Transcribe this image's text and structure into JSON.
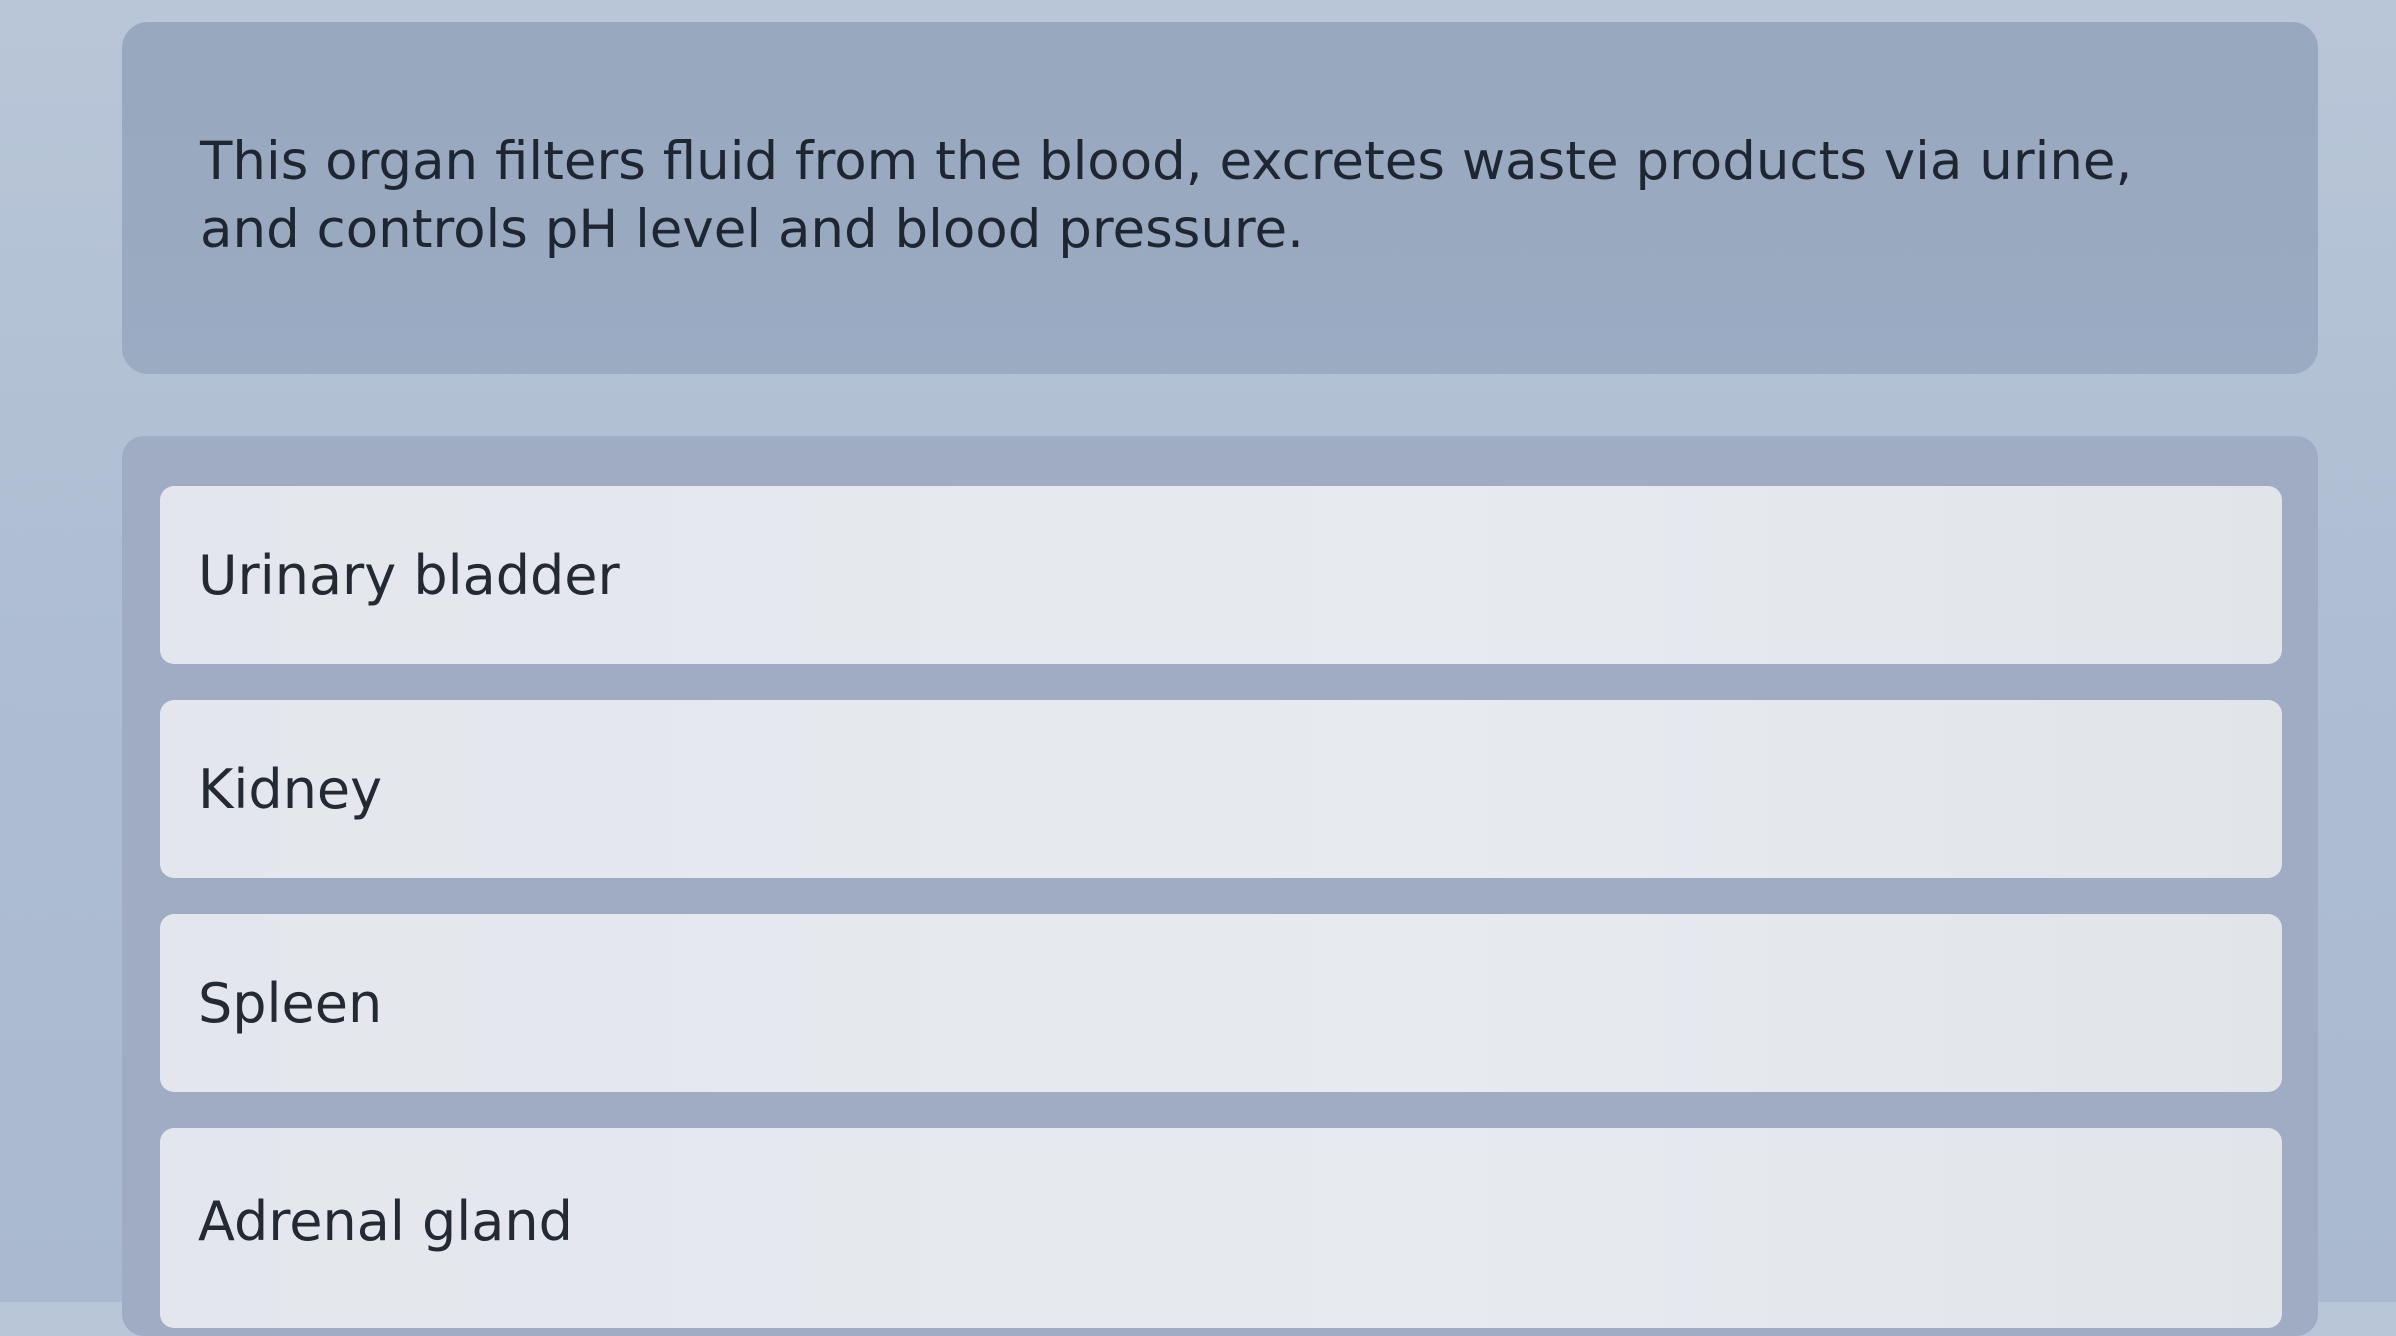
{
  "question": {
    "text": "This organ filters fluid from the blood, excretes waste products via urine, and controls pH level and blood pressure."
  },
  "options": [
    {
      "label": "Urinary bladder"
    },
    {
      "label": "Kidney"
    },
    {
      "label": "Spleen"
    },
    {
      "label": "Adrenal gland"
    }
  ],
  "colors": {
    "background": "#b9c6d8",
    "question_card": "#98a8be",
    "answers_panel": "#9facc3",
    "option_bg": "#e5e9ee",
    "text": "#1e2632"
  }
}
